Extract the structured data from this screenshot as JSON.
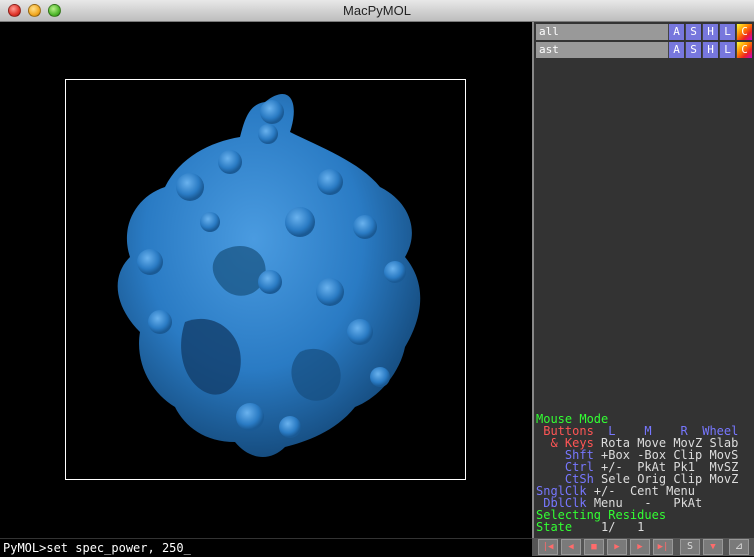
{
  "window": {
    "title": "MacPyMOL"
  },
  "command_line": {
    "text": "PyMOL>set spec_power, 250_"
  },
  "objects": [
    {
      "name": "all",
      "buttons": [
        "A",
        "S",
        "H",
        "L",
        "C"
      ]
    },
    {
      "name": "ast",
      "buttons": [
        "A",
        "S",
        "H",
        "L",
        "C"
      ]
    }
  ],
  "mouse_mode": {
    "title": "Mouse Mode",
    "header": {
      "buttons": "Buttons",
      "l": "L",
      "m": "M",
      "r": "R",
      "wheel": "Wheel"
    },
    "rows": [
      {
        "key": "& Keys",
        "l": "Rota",
        "m": "Move",
        "r": "MovZ",
        "wheel": "Slab"
      },
      {
        "key": "Shft",
        "l": "+Box",
        "m": "-Box",
        "r": "Clip",
        "wheel": "MovS"
      },
      {
        "key": "Ctrl",
        "l": "+/-",
        "m": "PkAt",
        "r": "Pk1",
        "wheel": "MvSZ"
      },
      {
        "key": "CtSh",
        "l": "Sele",
        "m": "Orig",
        "r": "Clip",
        "wheel": "MovZ"
      },
      {
        "key": "SnglClk",
        "l": "+/-",
        "m": "Cent",
        "r": "Menu",
        "wheel": ""
      },
      {
        "key": "DblClk",
        "l": "Menu",
        "m": "-",
        "r": "PkAt",
        "wheel": ""
      }
    ],
    "selecting": "Selecting Residues",
    "state_label": "State",
    "state_value": "1/",
    "state_total": "1"
  },
  "playback": {
    "buttons": [
      "first-frame",
      "prev-frame",
      "stop",
      "play",
      "next-frame",
      "last-frame",
      "scene",
      "menu",
      "resize"
    ],
    "labels": [
      "|◀",
      "◀",
      "■",
      "▶",
      "▶",
      "▶|",
      "S",
      "▼",
      "⊿"
    ]
  },
  "colors": {
    "molecule": "#2a7bc4",
    "viewer_bg": "#000000",
    "panel_bg": "#333333",
    "mouse_mode_title": "#33ff33",
    "buttons_label": "#ff5555",
    "button_blue": "#7777dd"
  }
}
